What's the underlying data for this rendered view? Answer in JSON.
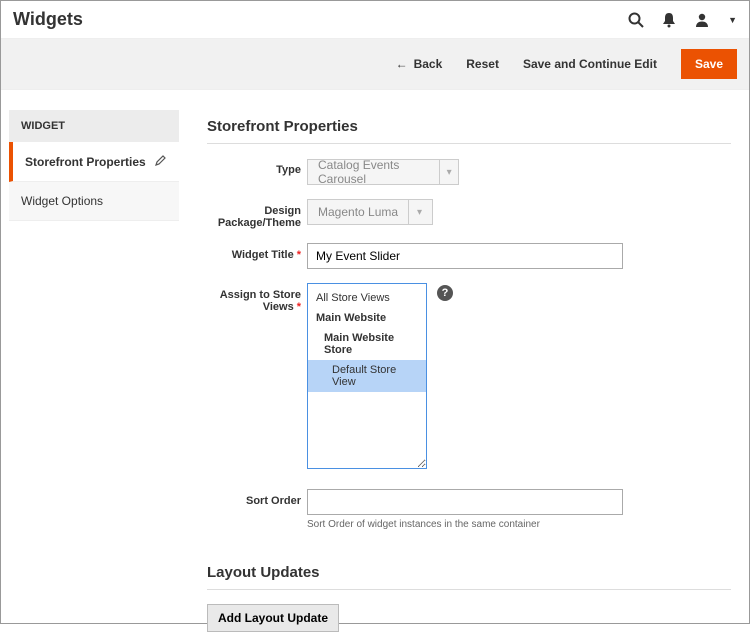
{
  "header": {
    "title": "Widgets"
  },
  "toolbar": {
    "back": "Back",
    "reset": "Reset",
    "save_continue": "Save and Continue Edit",
    "save": "Save"
  },
  "sidebar": {
    "heading": "WIDGET",
    "items": [
      {
        "label": "Storefront Properties",
        "active": true
      },
      {
        "label": "Widget Options",
        "active": false
      }
    ]
  },
  "section": {
    "storefront_title": "Storefront Properties",
    "layout_title": "Layout Updates"
  },
  "fields": {
    "type": {
      "label": "Type",
      "value": "Catalog Events Carousel"
    },
    "theme": {
      "label": "Design Package/Theme",
      "value": "Magento Luma"
    },
    "widget_title": {
      "label": "Widget Title",
      "value": "My Event Slider"
    },
    "assign": {
      "label": "Assign to Store Views",
      "options": {
        "all": "All Store Views",
        "main_website": "Main Website",
        "main_store": "Main Website Store",
        "default_view": "Default Store View"
      },
      "selected": "Default Store View"
    },
    "sort_order": {
      "label": "Sort Order",
      "value": "",
      "hint": "Sort Order of widget instances in the same container"
    }
  },
  "buttons": {
    "add_layout": "Add Layout Update"
  }
}
